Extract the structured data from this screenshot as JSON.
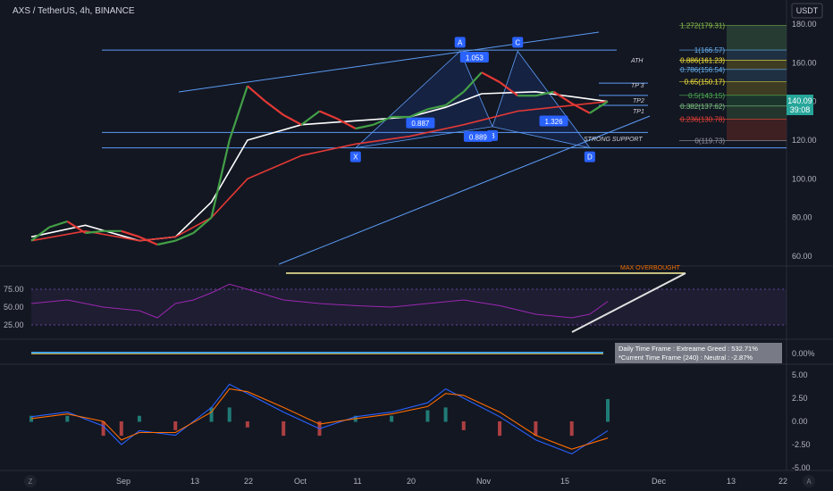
{
  "header": {
    "symbol_title": "AXS / TetherUS, 4h, BINANCE",
    "currency_label": "USDT"
  },
  "price_panel": {
    "axis_ticks": [
      "180.00",
      "160.00",
      "140.00",
      "120.00",
      "100.00",
      "80.00",
      "60.00"
    ],
    "current_price": "140.09",
    "countdown": "39:08",
    "fib_levels": [
      {
        "label": "1.272(179.31)",
        "color": "#8bc34a"
      },
      {
        "label": "1(166.57)",
        "color": "#64b5f6"
      },
      {
        "label": "0.886(161.23)",
        "color": "#ffeb3b"
      },
      {
        "label": "0.786(156.54)",
        "color": "#64b5f6"
      },
      {
        "label": "0.65(150.17)",
        "color": "#ffeb3b"
      },
      {
        "label": "0.5(143.15)",
        "color": "#4caf50"
      },
      {
        "label": "0.382(137.62)",
        "color": "#81c784"
      },
      {
        "label": "0.236(130.78)",
        "color": "#f44336"
      },
      {
        "label": "0(119.73)",
        "color": "#9598a1"
      }
    ],
    "harmonic_points": [
      "X",
      "A",
      "B",
      "C",
      "D"
    ],
    "ratios": [
      "1.053",
      "0.887",
      "0.889",
      "1.326"
    ],
    "annotations": {
      "ath": "ATH",
      "tp3": "TP 3",
      "tp2": "TP2",
      "tp1": "TP1",
      "strong_support": "STRONG SUPPORT"
    }
  },
  "rsi_panel": {
    "axis_ticks": [
      "75.00",
      "50.00",
      "25.00"
    ],
    "annotation": "MAX OVERBOUGHT"
  },
  "sentiment_panel": {
    "axis_tick": "0.00%",
    "daily_text": "Daily Time Frame : Extreame Greed : 532.71%",
    "current_text": "*Current Time Frame (240) : Neutral : -2.87%"
  },
  "macd_panel": {
    "axis_ticks": [
      "5.00",
      "2.50",
      "0.00",
      "-2.50",
      "-5.00"
    ]
  },
  "time_axis": {
    "labels": [
      "Sep",
      "13",
      "22",
      "Oct",
      "11",
      "20",
      "Nov",
      "15",
      "Dec",
      "13",
      "22"
    ]
  },
  "corner_buttons": {
    "left": "Z",
    "right": "A"
  },
  "colors": {
    "background": "#131722",
    "bull": "#26a69a",
    "bear": "#ef5350",
    "rsi": "#9c27b0",
    "trendline": "#5b9cf6"
  },
  "chart_data": {
    "type": "line",
    "title": "AXS / TetherUS, 4h, BINANCE",
    "price_series": [
      [
        0,
        68
      ],
      [
        5,
        75
      ],
      [
        10,
        78
      ],
      [
        15,
        72
      ],
      [
        20,
        73
      ],
      [
        25,
        73
      ],
      [
        30,
        70
      ],
      [
        35,
        66
      ],
      [
        40,
        68
      ],
      [
        45,
        72
      ],
      [
        50,
        80
      ],
      [
        55,
        120
      ],
      [
        60,
        148
      ],
      [
        65,
        140
      ],
      [
        70,
        133
      ],
      [
        75,
        128
      ],
      [
        80,
        135
      ],
      [
        85,
        131
      ],
      [
        90,
        126
      ],
      [
        95,
        128
      ],
      [
        100,
        132
      ],
      [
        105,
        132
      ],
      [
        110,
        136
      ],
      [
        115,
        138
      ],
      [
        120,
        145
      ],
      [
        125,
        155
      ],
      [
        130,
        150
      ],
      [
        135,
        143
      ],
      [
        140,
        143
      ],
      [
        145,
        145
      ],
      [
        150,
        139
      ],
      [
        155,
        134
      ],
      [
        160,
        140
      ]
    ],
    "moving_averages": [
      {
        "color": "#ffffff",
        "values": [
          [
            0,
            70
          ],
          [
            15,
            76
          ],
          [
            30,
            68
          ],
          [
            40,
            70
          ],
          [
            50,
            88
          ],
          [
            60,
            120
          ],
          [
            75,
            128
          ],
          [
            90,
            130
          ],
          [
            105,
            132
          ],
          [
            115,
            137
          ],
          [
            125,
            144
          ],
          [
            140,
            145
          ],
          [
            160,
            140
          ]
        ]
      },
      {
        "color": "#e53935",
        "values": [
          [
            0,
            68
          ],
          [
            15,
            73
          ],
          [
            30,
            68
          ],
          [
            40,
            70
          ],
          [
            50,
            80
          ],
          [
            60,
            100
          ],
          [
            75,
            112
          ],
          [
            90,
            118
          ],
          [
            105,
            122
          ],
          [
            120,
            128
          ],
          [
            135,
            135
          ],
          [
            160,
            140
          ]
        ]
      }
    ],
    "fibonacci": [
      {
        "ratio": 1.272,
        "price": 179.31
      },
      {
        "ratio": 1,
        "price": 166.57
      },
      {
        "ratio": 0.886,
        "price": 161.23
      },
      {
        "ratio": 0.786,
        "price": 156.54
      },
      {
        "ratio": 0.65,
        "price": 150.17
      },
      {
        "ratio": 0.5,
        "price": 143.15
      },
      {
        "ratio": 0.382,
        "price": 137.62
      },
      {
        "ratio": 0.236,
        "price": 130.78
      },
      {
        "ratio": 0,
        "price": 119.73
      }
    ],
    "harmonic": [
      {
        "label": "X",
        "t": 90,
        "price": 116
      },
      {
        "label": "A",
        "t": 119,
        "price": 166
      },
      {
        "label": "B",
        "t": 128,
        "price": 127
      },
      {
        "label": "C",
        "t": 135,
        "price": 166
      },
      {
        "label": "D",
        "t": 155,
        "price": 116
      }
    ],
    "rsi": [
      [
        0,
        55
      ],
      [
        10,
        60
      ],
      [
        20,
        50
      ],
      [
        30,
        45
      ],
      [
        35,
        35
      ],
      [
        40,
        55
      ],
      [
        45,
        60
      ],
      [
        50,
        70
      ],
      [
        55,
        82
      ],
      [
        60,
        75
      ],
      [
        70,
        60
      ],
      [
        80,
        55
      ],
      [
        90,
        52
      ],
      [
        100,
        50
      ],
      [
        110,
        55
      ],
      [
        120,
        60
      ],
      [
        130,
        52
      ],
      [
        140,
        40
      ],
      [
        150,
        35
      ],
      [
        155,
        40
      ],
      [
        160,
        58
      ]
    ],
    "macd": [
      [
        0,
        0.5
      ],
      [
        10,
        1.0
      ],
      [
        20,
        -0.5
      ],
      [
        25,
        -2.5
      ],
      [
        30,
        -1.0
      ],
      [
        40,
        -1.5
      ],
      [
        50,
        1.5
      ],
      [
        55,
        4.0
      ],
      [
        60,
        3.0
      ],
      [
        70,
        1.0
      ],
      [
        80,
        -0.8
      ],
      [
        90,
        0.5
      ],
      [
        100,
        1.0
      ],
      [
        110,
        2.0
      ],
      [
        115,
        3.5
      ],
      [
        120,
        2.5
      ],
      [
        130,
        0.5
      ],
      [
        140,
        -2.0
      ],
      [
        150,
        -3.5
      ],
      [
        160,
        -1.0
      ]
    ],
    "signal": [
      [
        0,
        0.3
      ],
      [
        10,
        0.8
      ],
      [
        20,
        0.0
      ],
      [
        25,
        -2.0
      ],
      [
        30,
        -1.2
      ],
      [
        40,
        -1.2
      ],
      [
        50,
        1.0
      ],
      [
        55,
        3.5
      ],
      [
        60,
        3.2
      ],
      [
        70,
        1.5
      ],
      [
        80,
        -0.3
      ],
      [
        90,
        0.3
      ],
      [
        100,
        0.8
      ],
      [
        110,
        1.6
      ],
      [
        115,
        3.0
      ],
      [
        120,
        2.8
      ],
      [
        130,
        1.0
      ],
      [
        140,
        -1.5
      ],
      [
        150,
        -3.0
      ],
      [
        160,
        -1.8
      ]
    ],
    "ylim": [
      55,
      185
    ],
    "rsi_ylim": [
      20,
      88
    ],
    "macd_ylim": [
      -5.5,
      5.5
    ]
  }
}
